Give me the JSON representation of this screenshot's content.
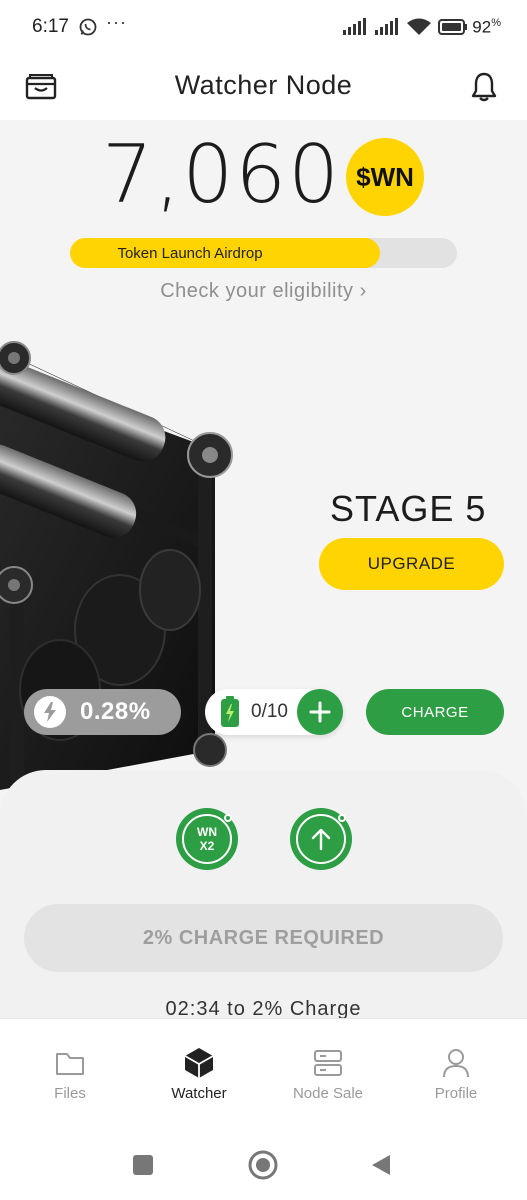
{
  "status_bar": {
    "time": "6:17",
    "battery_percent": "92",
    "battery_suffix": "%"
  },
  "header": {
    "title": "Watcher Node",
    "left_icon": "wallet-icon",
    "right_icon": "bell-icon"
  },
  "balance": {
    "value": "7,060",
    "token_symbol": "$WN"
  },
  "airdrop": {
    "label": "Token Launch Airdrop",
    "progress": 0.8,
    "link_text": "Check your eligibility ›"
  },
  "stage": {
    "label": "STAGE 5",
    "upgrade_label": "UPGRADE"
  },
  "charge": {
    "percent": "0.28%",
    "battery_count": "0/10",
    "charge_button": "CHARGE"
  },
  "boosts": {
    "x2_line1": "WN",
    "x2_line2": "X2"
  },
  "action": {
    "required_label": "2% CHARGE REQUIRED",
    "countdown": "02:34  to 2% Charge"
  },
  "nav": {
    "items": [
      {
        "label": "Files",
        "icon": "folder-icon"
      },
      {
        "label": "Watcher",
        "icon": "cube-icon"
      },
      {
        "label": "Node Sale",
        "icon": "server-icon"
      },
      {
        "label": "Profile",
        "icon": "user-icon"
      }
    ],
    "active": "Watcher"
  },
  "colors": {
    "accent_yellow": "#ffd400",
    "accent_green": "#2e9e44",
    "background": "#f4f4f4"
  }
}
